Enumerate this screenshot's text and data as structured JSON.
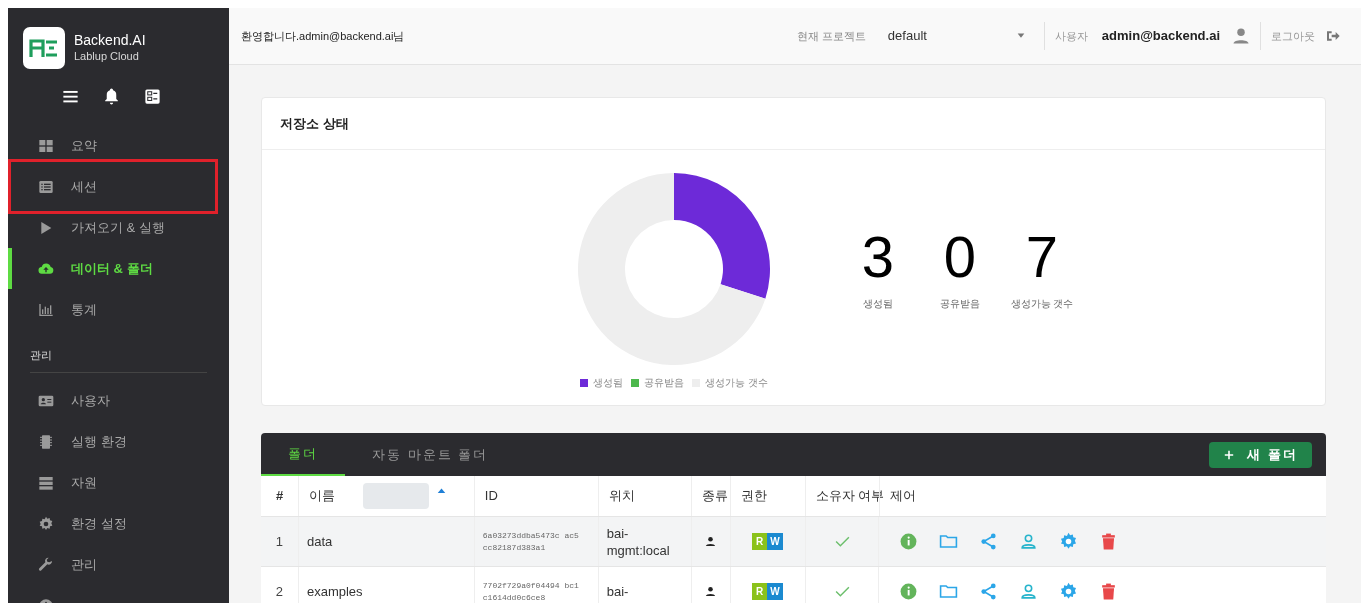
{
  "brand": {
    "title": "Backend.AI",
    "subtitle": "Lablup Cloud"
  },
  "sidebar": {
    "items": [
      {
        "label": "요약",
        "selected": false,
        "highlighted": false
      },
      {
        "label": "세션",
        "selected": false,
        "highlighted": true
      },
      {
        "label": "가져오기 & 실행",
        "selected": false,
        "highlighted": false
      },
      {
        "label": "데이터 & 폴더",
        "selected": true,
        "highlighted": false
      },
      {
        "label": "통계",
        "selected": false,
        "highlighted": false
      }
    ],
    "section": "관리",
    "admin_items": [
      {
        "label": "사용자",
        "selected": false,
        "highlighted": false
      },
      {
        "label": "실행 환경",
        "selected": false,
        "highlighted": false
      },
      {
        "label": "자원",
        "selected": false,
        "highlighted": false
      },
      {
        "label": "환경 설정",
        "selected": false,
        "highlighted": false
      },
      {
        "label": "관리",
        "selected": false,
        "highlighted": false
      }
    ]
  },
  "header": {
    "welcome": "환영합니다.admin@backend.ai님",
    "project_label": "현재 프로젝트",
    "project": "default",
    "user_label": "사용자",
    "user": "admin@backend.ai",
    "logout": "로그아웃"
  },
  "storage": {
    "title": "저장소 상태",
    "chart_data": {
      "type": "donut",
      "categories": [
        "생성됨",
        "공유받음",
        "생성가능 갯수"
      ],
      "series": [
        {
          "values": [
            30,
            0,
            70
          ]
        }
      ]
    },
    "stats": [
      {
        "value": "3",
        "label": "생성됨"
      },
      {
        "value": "0",
        "label": "공유받음"
      },
      {
        "value": "7",
        "label": "생성가능 갯수"
      }
    ]
  },
  "folders": {
    "tabs": [
      {
        "label": "폴더",
        "selected": true
      },
      {
        "label": "자동 마운트 폴더",
        "selected": false
      }
    ],
    "new_button": "새 폴더",
    "columns": [
      "#",
      "이름",
      "ID",
      "위치",
      "종류",
      "권한",
      "소유자 여부",
      "제어"
    ],
    "rows": [
      {
        "index": "1",
        "name": "data",
        "id": "6a03273ddba5473c ac5cc82187d383a1",
        "location": "bai-mgmt:local",
        "read": "R",
        "write": "W",
        "owner": true
      },
      {
        "index": "2",
        "name": "examples",
        "id": "7702f729a0f04494 bc1c1614dd0c6ce8",
        "location": "bai-",
        "read": "R",
        "write": "W",
        "owner": true
      }
    ]
  }
}
